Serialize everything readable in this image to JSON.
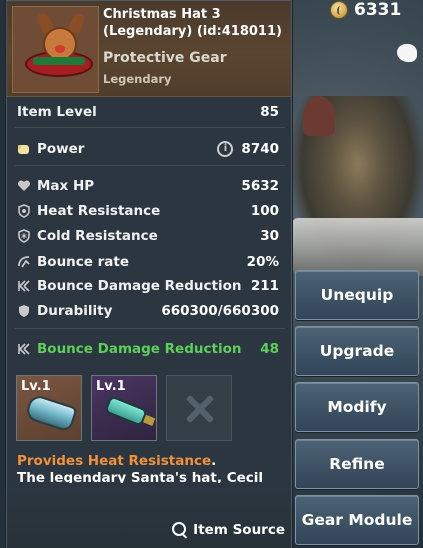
{
  "currency": {
    "value": "6331",
    "icon": "coin-icon"
  },
  "item": {
    "title_line1": "Christmas Hat 3",
    "title_line2": "(Legendary) (id:418011)",
    "category": "Protective Gear",
    "rarity": "Legendary"
  },
  "stats": {
    "item_level": {
      "label": "Item Level",
      "value": "85"
    },
    "power": {
      "label": "Power",
      "value": "8740"
    },
    "max_hp": {
      "label": "Max HP",
      "value": "5632"
    },
    "heat_resistance": {
      "label": "Heat Resistance",
      "value": "100"
    },
    "cold_resistance": {
      "label": "Cold Resistance",
      "value": "30"
    },
    "bounce_rate": {
      "label": "Bounce rate",
      "value": "20%"
    },
    "bounce_damage_reduction": {
      "label": "Bounce Damage Reduction",
      "value": "211"
    },
    "durability": {
      "label": "Durability",
      "value": "660300/660300"
    }
  },
  "bonus_stat": {
    "label": "Bounce Damage Reduction",
    "value": "48",
    "color": "#5ecf5a"
  },
  "modules": [
    {
      "level": "Lv.1"
    },
    {
      "level": "Lv.1"
    }
  ],
  "description": {
    "highlight": "Provides Heat Resistance",
    "highlight_suffix": ".",
    "text": "The legendary Santa's hat, Cecil"
  },
  "footer": {
    "item_source": "Item Source"
  },
  "actions": {
    "unequip": "Unequip",
    "upgrade": "Upgrade",
    "modify": "Modify",
    "refine": "Refine",
    "gear_module": "Gear Module"
  },
  "colors": {
    "accent_orange": "#f0923a",
    "bonus_green": "#5ecf5a",
    "header_brown": "#5a4530"
  }
}
